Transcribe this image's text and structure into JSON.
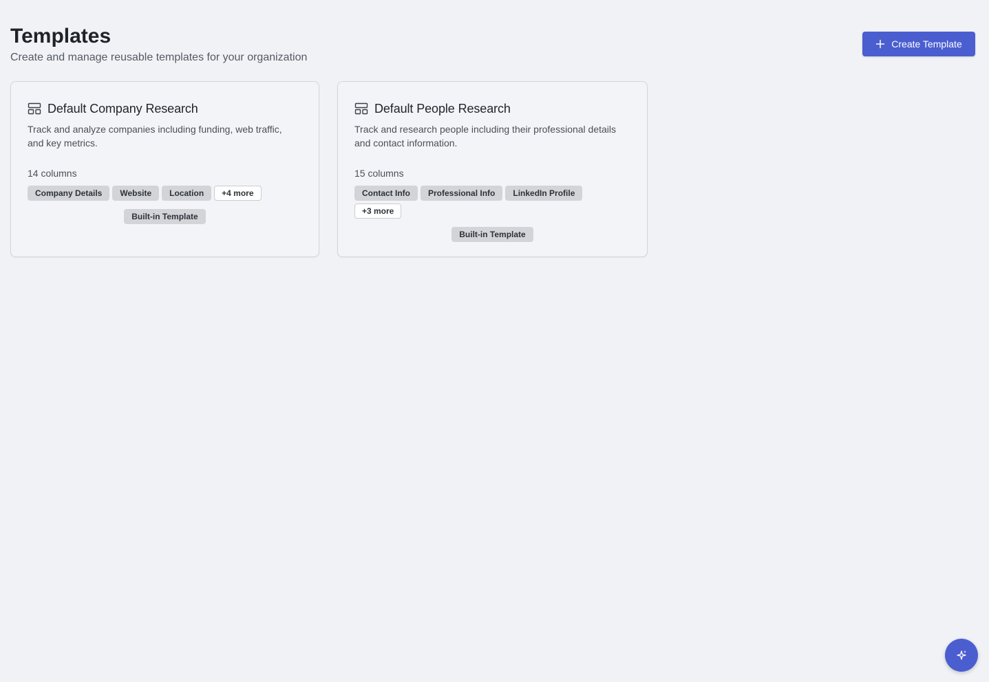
{
  "header": {
    "title": "Templates",
    "subtitle": "Create and manage reusable templates for your organization",
    "create_button_label": "Create Template"
  },
  "templates": [
    {
      "icon": "layout-template-icon",
      "title": "Default Company Research",
      "description": "Track and analyze companies including funding, web traffic, and key metrics.",
      "columns_label": "14 columns",
      "tags": [
        "Company Details",
        "Website",
        "Location"
      ],
      "more_label": "+4 more",
      "badge": "Built-in Template"
    },
    {
      "icon": "layout-template-icon",
      "title": "Default People Research",
      "description": "Track and research people including their professional details and contact information.",
      "columns_label": "15 columns",
      "tags": [
        "Contact Info",
        "Professional Info",
        "LinkedIn Profile"
      ],
      "more_label": "+3 more",
      "badge": "Built-in Template"
    }
  ],
  "fab": {
    "icon": "sparkles-icon"
  },
  "colors": {
    "accent": "#4a5ed0",
    "background": "#f0f2f6",
    "tag_background": "#d2d4d8"
  }
}
